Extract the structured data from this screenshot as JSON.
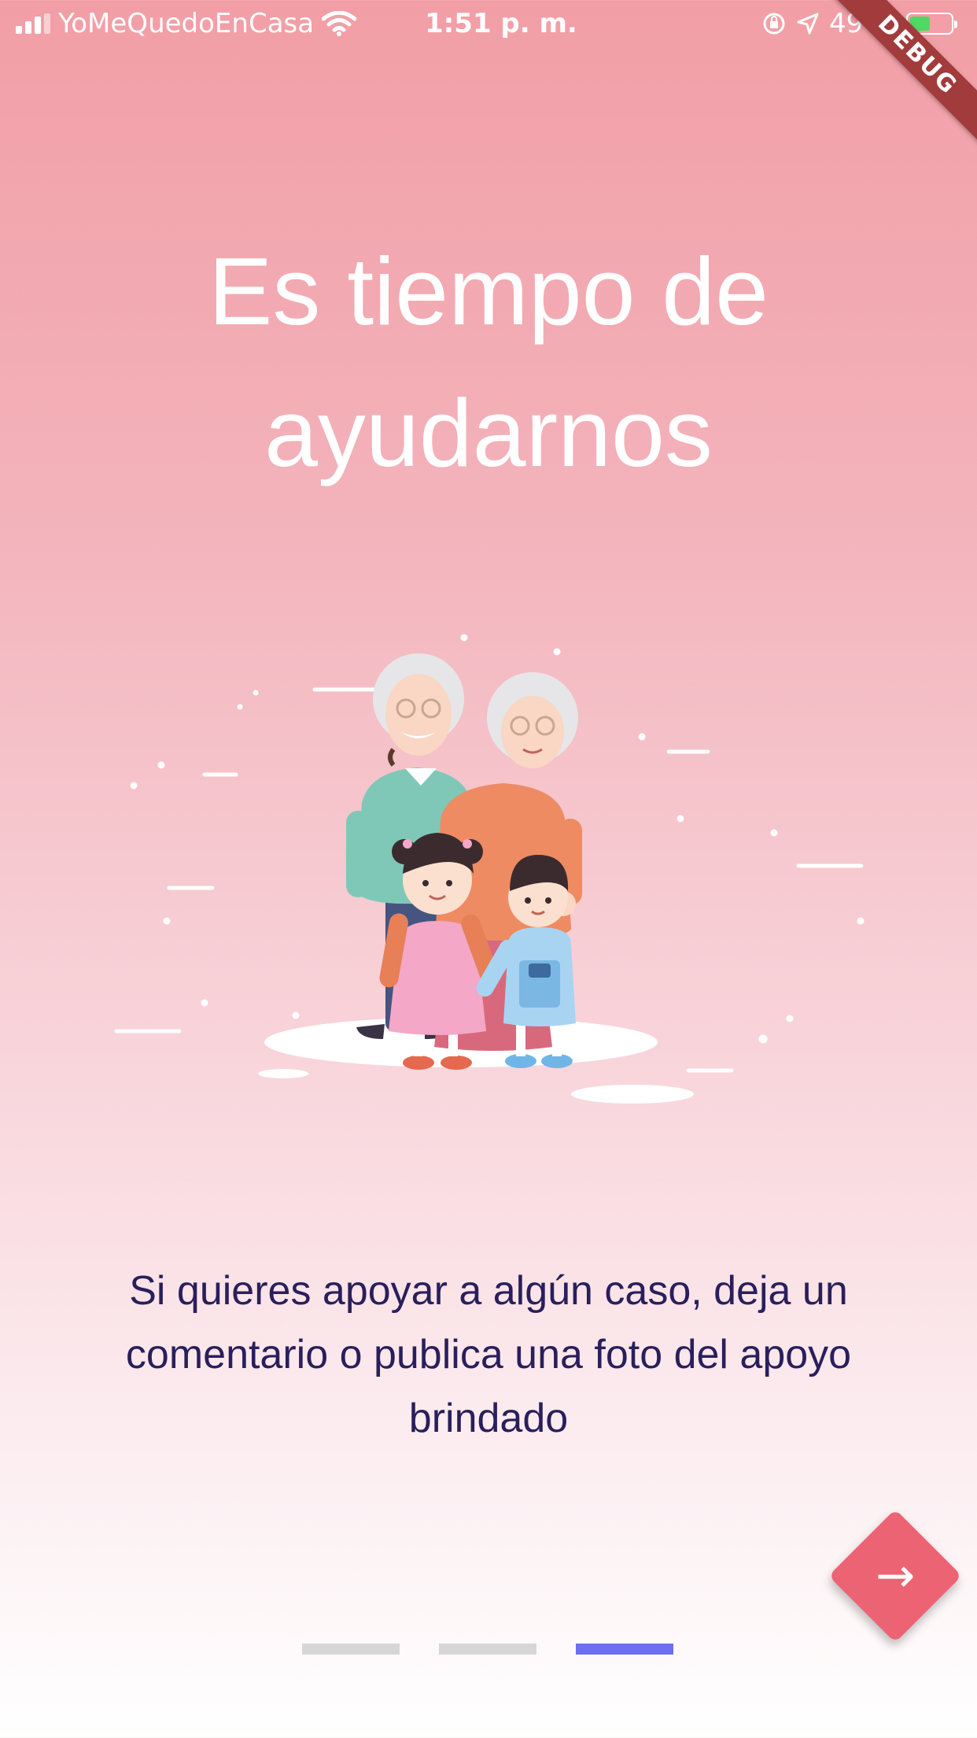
{
  "status_bar": {
    "carrier": "YoMeQuedoEnCasa",
    "time": "1:51 p. m.",
    "battery_percent": "49 %",
    "battery_level": 0.49
  },
  "debug_banner": "DEBUG",
  "onboarding": {
    "title": "Es tiempo de ayudarnos",
    "description": "Si quieres apoyar a algún  caso, deja un comentario o publica una foto del apoyo brindado",
    "illustration": "grandparents-and-children",
    "page_indicator": {
      "total": 3,
      "active": 3
    }
  },
  "colors": {
    "gradient_top": "#F29EA6",
    "gradient_bottom": "#FFFFFF",
    "title": "#FFFFFF",
    "description": "#2A1F5C",
    "next_button": "#EC6473",
    "indicator_active": "#6E6EF0",
    "indicator_inactive": "#D6D6D6"
  },
  "icons": {
    "next": "arrow-right-icon",
    "signal": "signal-icon",
    "wifi": "wifi-icon",
    "location": "location-arrow-icon",
    "lock": "orientation-lock-icon",
    "battery": "battery-charging-icon"
  }
}
